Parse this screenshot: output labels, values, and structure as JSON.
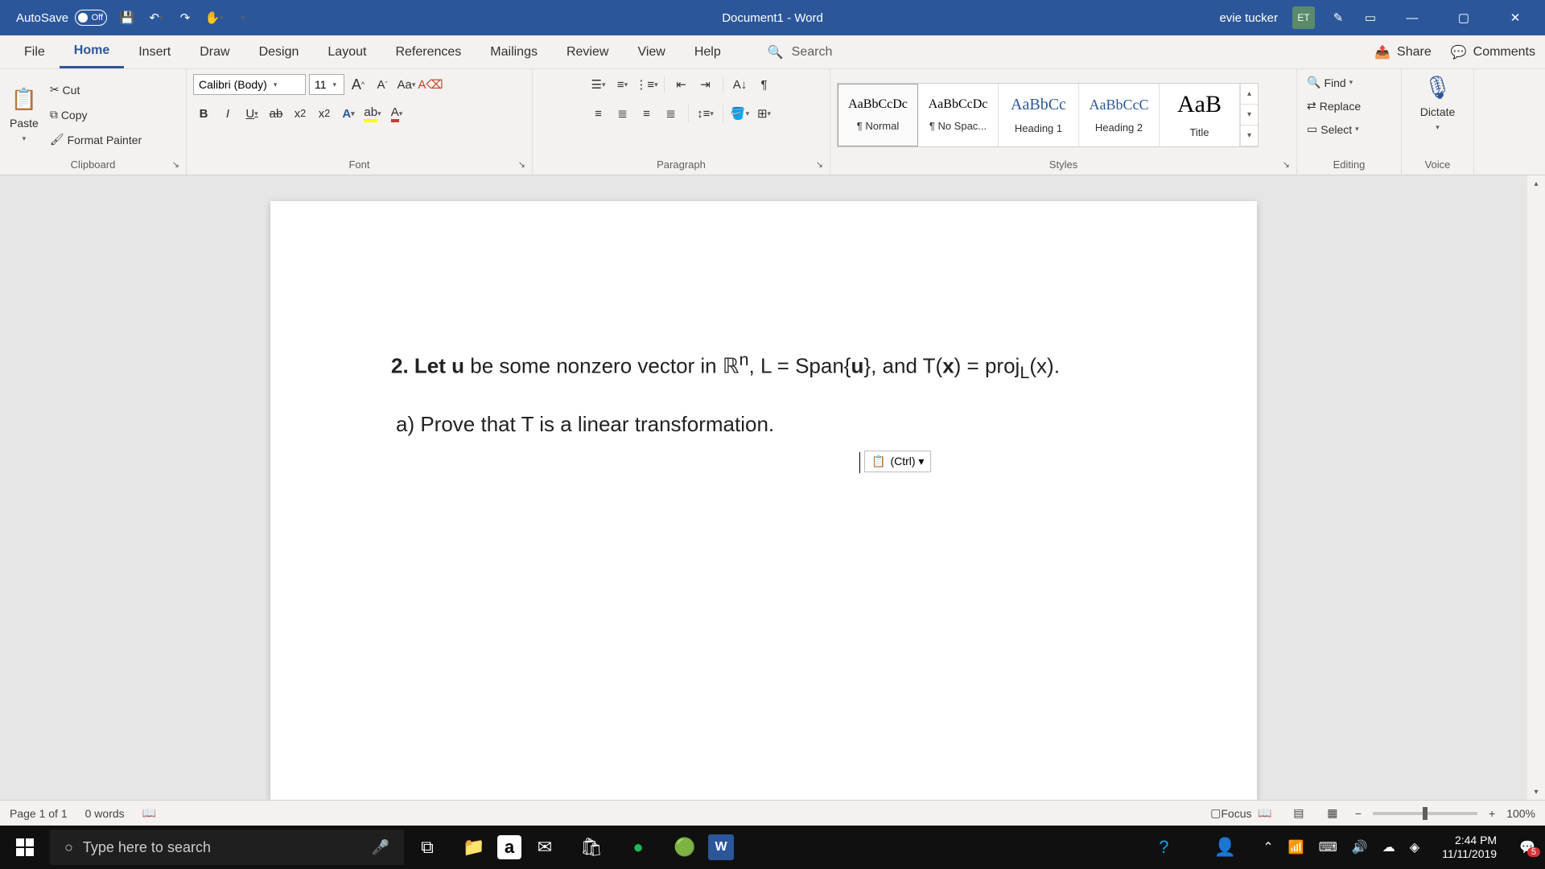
{
  "titleBar": {
    "autosave_label": "AutoSave",
    "autosave_state": "Off",
    "doc_title": "Document1 - Word",
    "user_name": "evie tucker",
    "user_initials": "ET"
  },
  "tabs": {
    "file": "File",
    "home": "Home",
    "insert": "Insert",
    "draw": "Draw",
    "design": "Design",
    "layout": "Layout",
    "references": "References",
    "mailings": "Mailings",
    "review": "Review",
    "view": "View",
    "help": "Help",
    "search_placeholder": "Search",
    "share": "Share",
    "comments": "Comments"
  },
  "ribbon": {
    "clipboard": {
      "paste": "Paste",
      "cut": "Cut",
      "copy": "Copy",
      "format_painter": "Format Painter",
      "label": "Clipboard"
    },
    "font": {
      "name": "Calibri (Body)",
      "size": "11",
      "label": "Font"
    },
    "paragraph": {
      "label": "Paragraph"
    },
    "styles": {
      "items": [
        {
          "preview": "AaBbCcDc",
          "name": "¶ Normal"
        },
        {
          "preview": "AaBbCcDc",
          "name": "¶ No Spac..."
        },
        {
          "preview": "AaBbCc",
          "name": "Heading 1"
        },
        {
          "preview": "AaBbCcC",
          "name": "Heading 2"
        },
        {
          "preview": "AaB",
          "name": "Title"
        }
      ],
      "label": "Styles"
    },
    "editing": {
      "find": "Find",
      "replace": "Replace",
      "select": "Select",
      "label": "Editing"
    },
    "voice": {
      "dictate": "Dictate",
      "label": "Voice"
    }
  },
  "document": {
    "line1_prefix": "2.  Let ",
    "line1_u": "u",
    "line1_mid1": " be some nonzero vector in ℝ",
    "line1_sup": "n",
    "line1_mid2": ", L = Span{",
    "line1_u2": "u",
    "line1_mid3": "}, and T(",
    "line1_x": "x",
    "line1_mid4": ") = proj",
    "line1_sub": "L",
    "line1_end": "(x).",
    "line2": "a)  Prove that T is a linear transformation.",
    "paste_tag": "(Ctrl) ▾"
  },
  "statusBar": {
    "page": "Page 1 of 1",
    "words": "0 words",
    "focus": "Focus",
    "zoom": "100%"
  },
  "taskbar": {
    "search_placeholder": "Type here to search",
    "time": "2:44 PM",
    "date": "11/11/2019",
    "notif_count": "5"
  }
}
